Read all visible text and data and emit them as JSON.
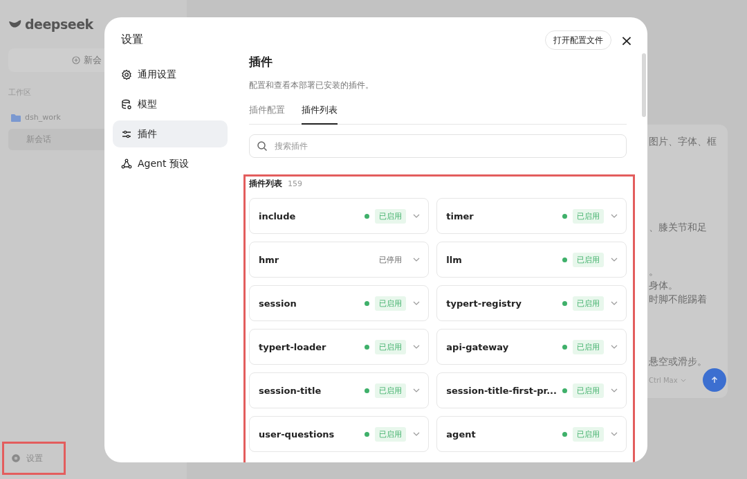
{
  "app": {
    "logo": "deepseek",
    "new_chat": "新会",
    "workspace_label": "工作区",
    "workspace": "dsh_work",
    "session": "新会话",
    "settings": {
      "label": "设置",
      "highlighted": true
    },
    "chat_lines": [
      "图片、字体、框",
      "、膝关节和足",
      "。",
      "身体。",
      "时脚不能踢着",
      "悬空或滑步。"
    ],
    "model": "Ctrl Max"
  },
  "dialog": {
    "title": "设置",
    "open_config": "打开配置文件",
    "close": "×",
    "nav": [
      {
        "label": "通用设置",
        "selected": false
      },
      {
        "label": "模型",
        "selected": false
      },
      {
        "label": "插件",
        "selected": true
      },
      {
        "label": "Agent 预设",
        "selected": false
      }
    ],
    "heading": "插件",
    "description": "配置和查看本部署已安装的插件。",
    "tabs": [
      {
        "label": "插件配置",
        "selected": false
      },
      {
        "label": "插件列表",
        "selected": true
      }
    ],
    "search": {
      "placeholder": "搜索插件"
    },
    "plugin_list": {
      "title": "插件列表",
      "count": "159",
      "highlighted": true,
      "plugins": [
        {
          "name": "include",
          "enabled": true,
          "status": "已启用"
        },
        {
          "name": "timer",
          "enabled": true,
          "status": "已启用"
        },
        {
          "name": "hmr",
          "enabled": false,
          "status": "已停用"
        },
        {
          "name": "llm",
          "enabled": true,
          "status": "已启用"
        },
        {
          "name": "session",
          "enabled": true,
          "status": "已启用"
        },
        {
          "name": "typert-registry",
          "enabled": true,
          "status": "已启用"
        },
        {
          "name": "typert-loader",
          "enabled": true,
          "status": "已启用"
        },
        {
          "name": "api-gateway",
          "enabled": true,
          "status": "已启用"
        },
        {
          "name": "session-title",
          "enabled": true,
          "status": "已启用"
        },
        {
          "name": "session-title-first-pr...",
          "enabled": true,
          "status": "已启用"
        },
        {
          "name": "user-questions",
          "enabled": true,
          "status": "已启用"
        },
        {
          "name": "agent",
          "enabled": true,
          "status": "已启用"
        }
      ]
    }
  }
}
